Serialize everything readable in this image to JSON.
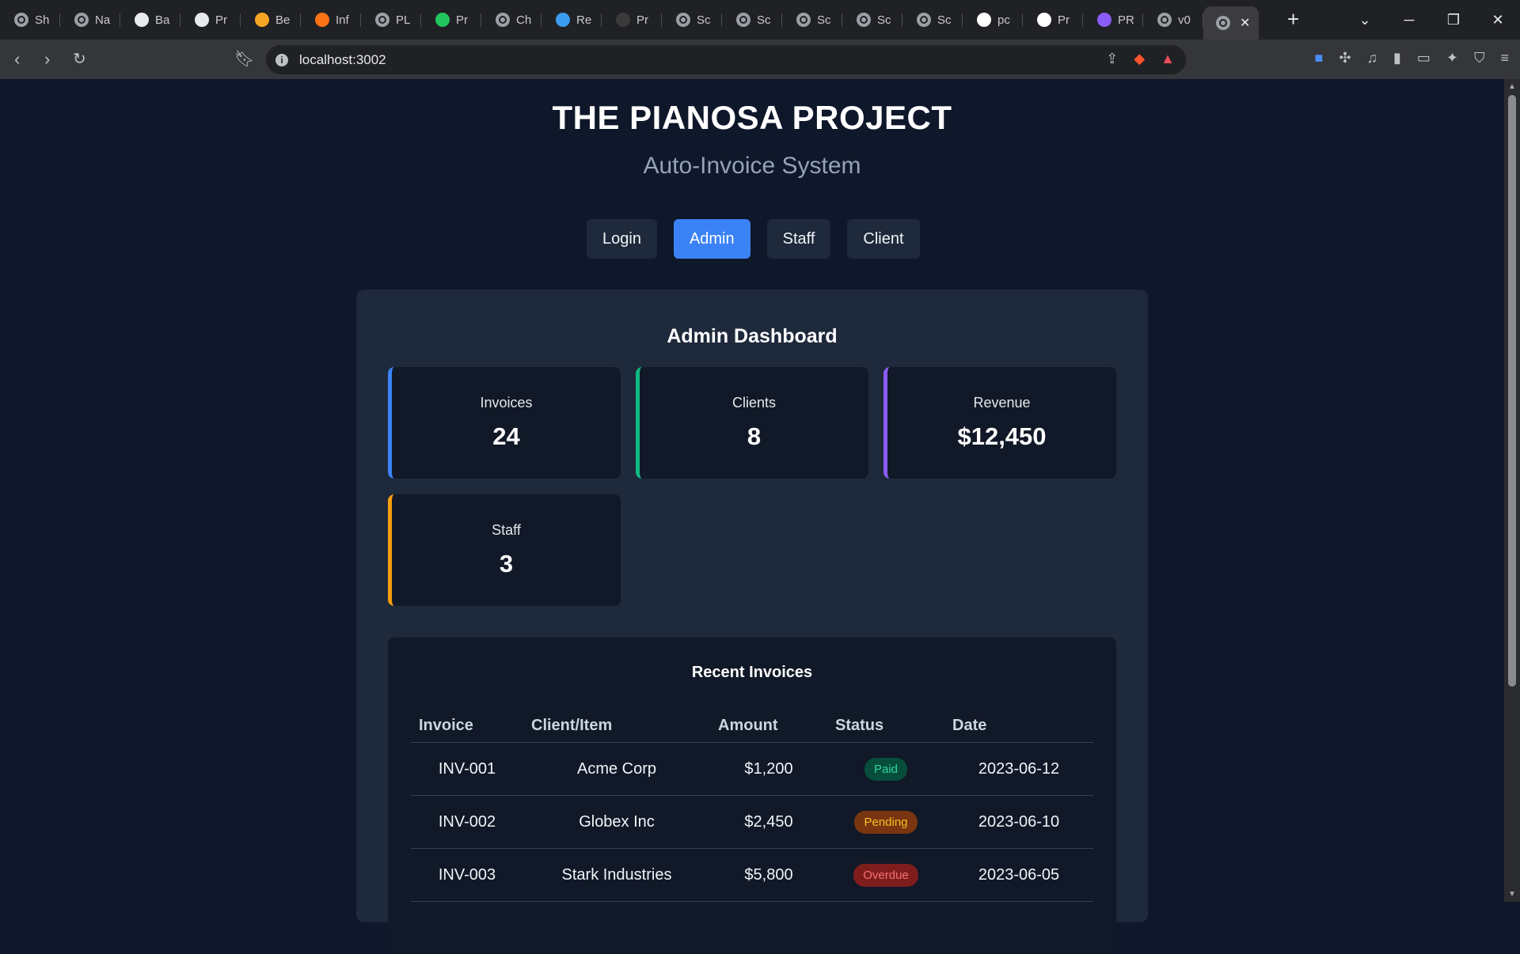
{
  "browser": {
    "tabs": [
      {
        "label": "Sh",
        "icon": "globe-icon",
        "color": "#9aa0a6"
      },
      {
        "label": "Na",
        "icon": "globe-icon",
        "color": "#9aa0a6"
      },
      {
        "label": "Ba",
        "icon": "openai-icon",
        "color": "#e8eaed"
      },
      {
        "label": "Pr",
        "icon": "square-icon",
        "color": "#e8eaed"
      },
      {
        "label": "Be",
        "icon": "orange-circle-icon",
        "color": "#f5a623"
      },
      {
        "label": "Inf",
        "icon": "branch-icon",
        "color": "#f97316"
      },
      {
        "label": "PL",
        "icon": "globe-icon",
        "color": "#9aa0a6"
      },
      {
        "label": "Pr",
        "icon": "bolt-icon",
        "color": "#22c55e"
      },
      {
        "label": "Ch",
        "icon": "globe-icon",
        "color": "#9aa0a6"
      },
      {
        "label": "Re",
        "icon": "vscode-icon",
        "color": "#3b9cf0"
      },
      {
        "label": "Pr",
        "icon": "dark-circle-icon",
        "color": "#3a3a3a"
      },
      {
        "label": "Sc",
        "icon": "globe-icon",
        "color": "#9aa0a6"
      },
      {
        "label": "Sc",
        "icon": "globe-icon",
        "color": "#9aa0a6"
      },
      {
        "label": "Sc",
        "icon": "globe-icon",
        "color": "#9aa0a6"
      },
      {
        "label": "Sc",
        "icon": "globe-icon",
        "color": "#9aa0a6"
      },
      {
        "label": "Sc",
        "icon": "globe-icon",
        "color": "#9aa0a6"
      },
      {
        "label": "pc",
        "icon": "triangle-icon",
        "color": "#ffffff"
      },
      {
        "label": "Pr",
        "icon": "v0-icon",
        "color": "#ffffff"
      },
      {
        "label": "PR",
        "icon": "purple-circle-icon",
        "color": "#8b5cf6"
      },
      {
        "label": "v0",
        "icon": "globe-icon",
        "color": "#9aa0a6"
      }
    ],
    "active_tab": {
      "icon": "globe-icon",
      "close": "✕"
    },
    "url": "localhost:3002"
  },
  "page": {
    "title": "THE PIANOSA PROJECT",
    "subtitle": "Auto-Invoice System",
    "roles": [
      {
        "label": "Login",
        "active": false
      },
      {
        "label": "Admin",
        "active": true
      },
      {
        "label": "Staff",
        "active": false
      },
      {
        "label": "Client",
        "active": false
      }
    ],
    "dashboard_title": "Admin Dashboard",
    "stats": [
      {
        "label": "Invoices",
        "value": "24",
        "accent": "#3b82f6"
      },
      {
        "label": "Clients",
        "value": "8",
        "accent": "#10b981"
      },
      {
        "label": "Revenue",
        "value": "$12,450",
        "accent": "#8b5cf6"
      },
      {
        "label": "Staff",
        "value": "3",
        "accent": "#f59e0b"
      }
    ],
    "recent_title": "Recent Invoices",
    "columns": [
      "Invoice",
      "Client/Item",
      "Amount",
      "Status",
      "Date"
    ],
    "rows": [
      {
        "invoice": "INV-001",
        "client": "Acme Corp",
        "amount": "$1,200",
        "status": "Paid",
        "date": "2023-06-12"
      },
      {
        "invoice": "INV-002",
        "client": "Globex Inc",
        "amount": "$2,450",
        "status": "Pending",
        "date": "2023-06-10"
      },
      {
        "invoice": "INV-003",
        "client": "Stark Industries",
        "amount": "$5,800",
        "status": "Overdue",
        "date": "2023-06-05"
      }
    ],
    "status_colors": {
      "Paid": {
        "bg": "#064e3b",
        "fg": "#34d399"
      },
      "Pending": {
        "bg": "#78350f",
        "fg": "#fbbf24"
      },
      "Overdue": {
        "bg": "#7f1d1d",
        "fg": "#f87171"
      }
    }
  }
}
